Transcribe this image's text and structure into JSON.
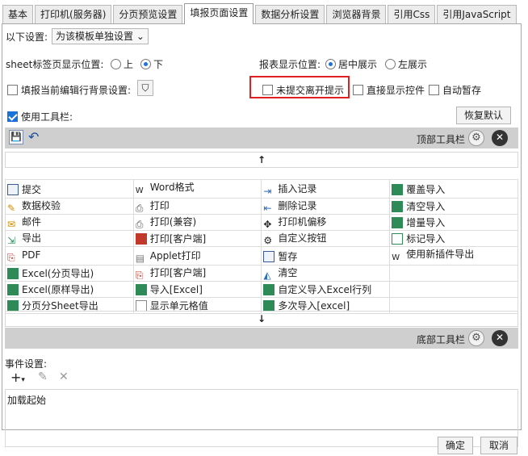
{
  "tabs": [
    "基本",
    "打印机(服务器)",
    "分页预览设置",
    "填报页面设置",
    "数据分析设置",
    "浏览器背景",
    "引用Css",
    "引用JavaScript"
  ],
  "settings": {
    "scope_label": "以下设置:",
    "scope_value": "为该模板单独设置",
    "sheet_pos_label": "sheet标签页显示位置:",
    "sheet_top": "上",
    "sheet_bottom": "下",
    "report_pos_label": "报表显示位置:",
    "report_center": "居中展示",
    "report_left": "左展示",
    "fill_bg_label": "填报当前编辑行背景设置:",
    "unsubmitted_label": "未提交离开提示",
    "direct_control_label": "直接显示控件",
    "autosave_label": "自动暂存",
    "use_toolbar_label": "使用工具栏:",
    "restore_default": "恢复默认"
  },
  "top_toolbar_label": "顶部工具栏",
  "bottom_toolbar_label": "底部工具栏",
  "grid": [
    [
      "提交",
      "Word格式",
      "插入记录",
      "覆盖导入"
    ],
    [
      "数据校验",
      "打印",
      "删除记录",
      "清空导入"
    ],
    [
      "邮件",
      "打印(兼容)",
      "打印机偏移",
      "增量导入"
    ],
    [
      "导出",
      "打印[客户端]",
      "自定义按钮",
      "标记导入"
    ],
    [
      "PDF",
      "Applet打印",
      "暂存",
      "使用新插件导出"
    ],
    [
      "Excel(分页导出)",
      "打印[客户端]",
      "清空",
      ""
    ],
    [
      "Excel(原样导出)",
      "导入[Excel]",
      "自定义导入Excel行列",
      ""
    ],
    [
      "分页分Sheet导出",
      "显示单元格值",
      "多次导入[excel]",
      ""
    ]
  ],
  "events": {
    "label": "事件设置:",
    "item": "加载起始"
  },
  "footer": {
    "ok": "确定",
    "cancel": "取消"
  },
  "colors": {
    "accent": "#1a73d9",
    "highlight_box": "#e02020"
  }
}
